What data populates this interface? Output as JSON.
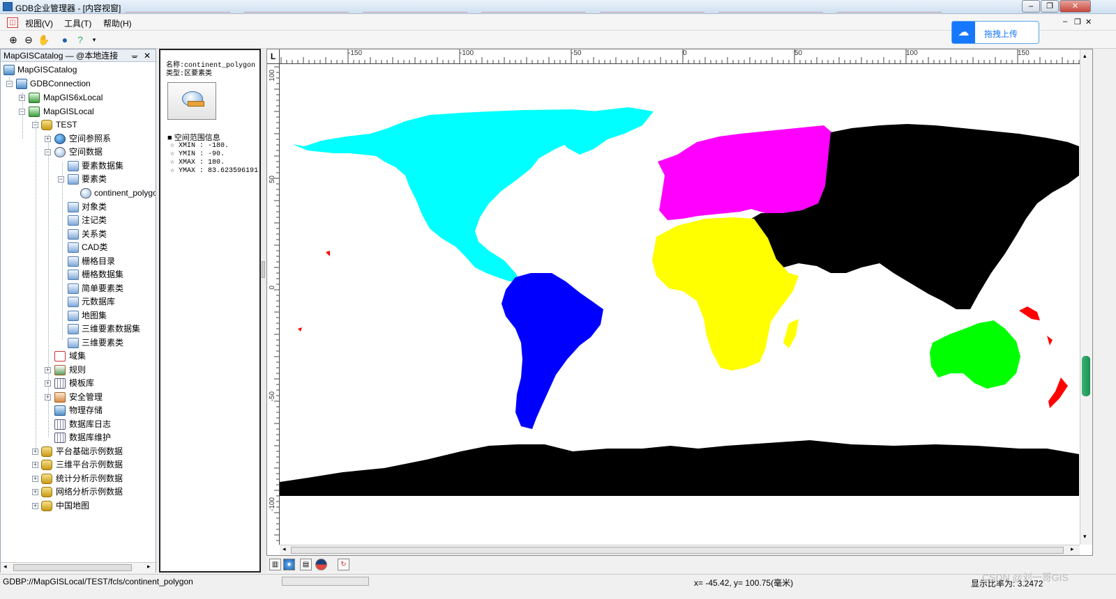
{
  "window": {
    "title": "GDB企业管理器 - [内容视窗]"
  },
  "menu": {
    "items": [
      "视图(V)",
      "工具(T)",
      "帮助(H)"
    ]
  },
  "toolbar": {
    "icons": [
      "zoom-in-icon",
      "zoom-out-icon",
      "pan-hand-icon",
      "globe-icon",
      "help-icon"
    ]
  },
  "upload": {
    "label": "拖拽上传",
    "accent": "#1677ff"
  },
  "catalog": {
    "header": "MapGISCatalog — @本地连接",
    "nodes": [
      {
        "label": "MapGISCatalog",
        "icon": "catalog-icon"
      },
      {
        "label": "GDBConnection",
        "icon": "connection-icon"
      },
      {
        "label": "MapGIS6xLocal",
        "icon": "server-icon"
      },
      {
        "label": "MapGISLocal",
        "icon": "server-icon"
      },
      {
        "label": "TEST",
        "icon": "database-icon"
      },
      {
        "label": "空间参照系",
        "icon": "globe-icon"
      },
      {
        "label": "空间数据",
        "icon": "spatial-data-icon"
      },
      {
        "label": "要素数据集",
        "icon": "folder-icon"
      },
      {
        "label": "要素类",
        "icon": "folder-icon"
      },
      {
        "label": "continent_polygon",
        "icon": "feature-class-icon"
      },
      {
        "label": "对象类",
        "icon": "folder-icon"
      },
      {
        "label": "注记类",
        "icon": "folder-icon"
      },
      {
        "label": "关系类",
        "icon": "folder-icon"
      },
      {
        "label": "CAD类",
        "icon": "folder-icon"
      },
      {
        "label": "栅格目录",
        "icon": "folder-icon"
      },
      {
        "label": "栅格数据集",
        "icon": "folder-icon"
      },
      {
        "label": "简单要素类",
        "icon": "folder-icon"
      },
      {
        "label": "元数据库",
        "icon": "folder-icon"
      },
      {
        "label": "地图集",
        "icon": "folder-icon"
      },
      {
        "label": "三维要素数据集",
        "icon": "folder-icon"
      },
      {
        "label": "三维要素类",
        "icon": "folder-icon"
      },
      {
        "label": "域集",
        "icon": "domain-icon"
      },
      {
        "label": "规则",
        "icon": "rule-icon"
      },
      {
        "label": "模板库",
        "icon": "template-icon"
      },
      {
        "label": "安全管理",
        "icon": "security-icon"
      },
      {
        "label": "物理存储",
        "icon": "storage-icon"
      },
      {
        "label": "数据库日志",
        "icon": "log-icon"
      },
      {
        "label": "数据库维护",
        "icon": "maintenance-icon"
      },
      {
        "label": "平台基础示例数据",
        "icon": "database-icon"
      },
      {
        "label": "三维平台示例数据",
        "icon": "database-icon"
      },
      {
        "label": "统计分析示例数据",
        "icon": "database-icon"
      },
      {
        "label": "网络分析示例数据",
        "icon": "database-icon"
      },
      {
        "label": "中国地图",
        "icon": "database-icon"
      }
    ]
  },
  "info": {
    "name": "名称:continent_polygon",
    "type": "类型:区要素类",
    "extent_title": "■ 空间范围信息",
    "xmin": "☆ XMIN : -180.",
    "ymin": "☆ YMIN : -90.",
    "xmax": "☆ XMAX : 180.",
    "ymax": "☆ YMAX : 83.623596191"
  },
  "map": {
    "corner_label": "L",
    "top_ticks": [
      "-150",
      "-100",
      "-50",
      "0",
      "50",
      "100",
      "150"
    ],
    "left_ticks": [
      "100",
      "50",
      "0",
      "-50",
      "-100"
    ],
    "continent_colors": {
      "north_america": "#00ffff",
      "south_america": "#0000ff",
      "europe": "#ff00ff",
      "africa": "#ffff00",
      "asia": "#000000",
      "oceania": "#00ff00",
      "antarctica": "#000000",
      "islands": "#ff0000"
    }
  },
  "status": {
    "path": "GDBP://MapGISLocal/TEST/fcls/continent_polygon",
    "coords": "x= -45.42, y= 100.75(毫米)",
    "scale": "显示比率为: 3.2472",
    "watermark": "CSDN @刘一哥GIS"
  }
}
